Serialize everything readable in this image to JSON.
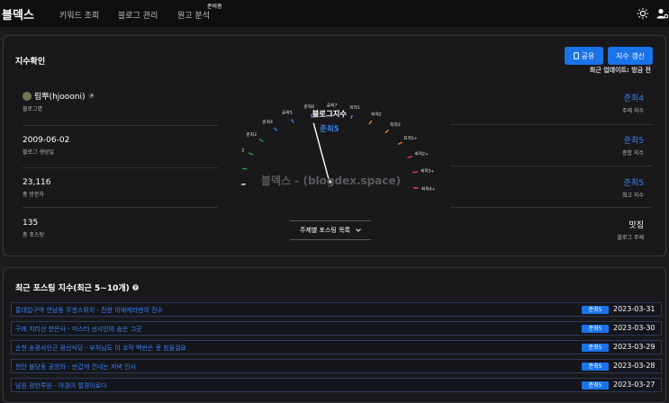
{
  "nav": {
    "brand": "블덱스",
    "links": [
      "키워드 조회",
      "블로그 관리",
      "원고 분석"
    ],
    "soon_badge": "준비중",
    "theme_icon": "sun-icon",
    "user_icon": "user-gear-icon"
  },
  "index_card": {
    "title": "지수확인",
    "share_label": "공유",
    "refresh_label": "지수 갱신",
    "update_note": "최근 업데이트: 방금 전",
    "left": [
      {
        "value": "림뿌(hjoooni)",
        "label": "블로그명"
      },
      {
        "value": "2009-06-02",
        "label": "블로그 생성일"
      },
      {
        "value": "23,116",
        "label": "총 방문자"
      },
      {
        "value": "135",
        "label": "총 포스팅"
      }
    ],
    "right": [
      {
        "value": "준최4",
        "label": "주제 지수"
      },
      {
        "value": "준최5",
        "label": "종합 지수"
      },
      {
        "value": "준최5",
        "label": "최고 지수"
      },
      {
        "value": "맛집",
        "label": "블로그 주제"
      }
    ],
    "gauge": {
      "title": "블로그지수",
      "value": "준최5",
      "level_index": 6,
      "ticks": [
        {
          "label": "일반",
          "color": "#ffffff"
        },
        {
          "label": "준최1",
          "color": "#2ea043"
        },
        {
          "label": "준최2",
          "color": "#2ea043"
        },
        {
          "label": "준최3",
          "color": "#2ea043"
        },
        {
          "label": "준최4",
          "color": "#3b82f6"
        },
        {
          "label": "준최5",
          "color": "#3b82f6"
        },
        {
          "label": "준최6",
          "color": "#a855f7"
        },
        {
          "label": "준최7",
          "color": "#a855f7"
        },
        {
          "label": "최적1",
          "color": "#a855f7"
        },
        {
          "label": "최적2",
          "color": "#f59e0b"
        },
        {
          "label": "최적3",
          "color": "#f59e0b"
        },
        {
          "label": "최적1+",
          "color": "#f97316"
        },
        {
          "label": "최적2+",
          "color": "#ef4444"
        },
        {
          "label": "최적3+",
          "color": "#ef4444"
        },
        {
          "label": "최적4+",
          "color": "#ef4444"
        }
      ]
    },
    "watermark": "블덱스 - (blogdex.space)",
    "dropdown_label": "주제별 포스팅 목록"
  },
  "posts_card": {
    "title": "최근 포스팅 지수(최근 5~10개)",
    "posts": [
      {
        "title": "홍대입구역 연남동 무겐스위치 - 진한 이에케라멘의 진수",
        "badge": "준최5",
        "date": "2023-03-31"
      },
      {
        "title": "구례 지리산 천은사 - 미스터 선샤인의 숨은 그곳",
        "badge": "준최5",
        "date": "2023-03-30"
      },
      {
        "title": "순천 송광사인근 광신식당 - 부처님도 이 꼬막 백반은 못 참을걸요",
        "badge": "준최5",
        "date": "2023-03-29"
      },
      {
        "title": "천안 불당동 공방와 - 반갑게 건네는 저녁 인사",
        "badge": "준최5",
        "date": "2023-03-28"
      },
      {
        "title": "남원 광한루원 - 아경이 절경이로다",
        "badge": "준최5",
        "date": "2023-03-27"
      }
    ]
  }
}
